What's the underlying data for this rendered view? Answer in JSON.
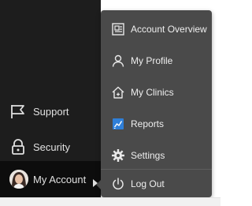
{
  "sidebar": {
    "items": [
      {
        "label": "Support",
        "icon": "flag-icon"
      },
      {
        "label": "Security",
        "icon": "lock-icon"
      },
      {
        "label": "My Account",
        "icon": "avatar"
      }
    ]
  },
  "account_menu": {
    "items": [
      {
        "label": "Account Overview",
        "icon": "account-overview-icon"
      },
      {
        "label": "My Profile",
        "icon": "user-icon"
      },
      {
        "label": "My Clinics",
        "icon": "clinic-icon"
      },
      {
        "label": "Reports",
        "icon": "reports-icon"
      },
      {
        "label": "Settings",
        "icon": "gear-icon"
      },
      {
        "label": "Log Out",
        "icon": "power-icon"
      }
    ]
  },
  "colors": {
    "sidebar_bg": "#1d1d1d",
    "menu_bg": "#4a4a4a",
    "text": "#eeeeee",
    "reports_accent": "#2f7fd8"
  }
}
